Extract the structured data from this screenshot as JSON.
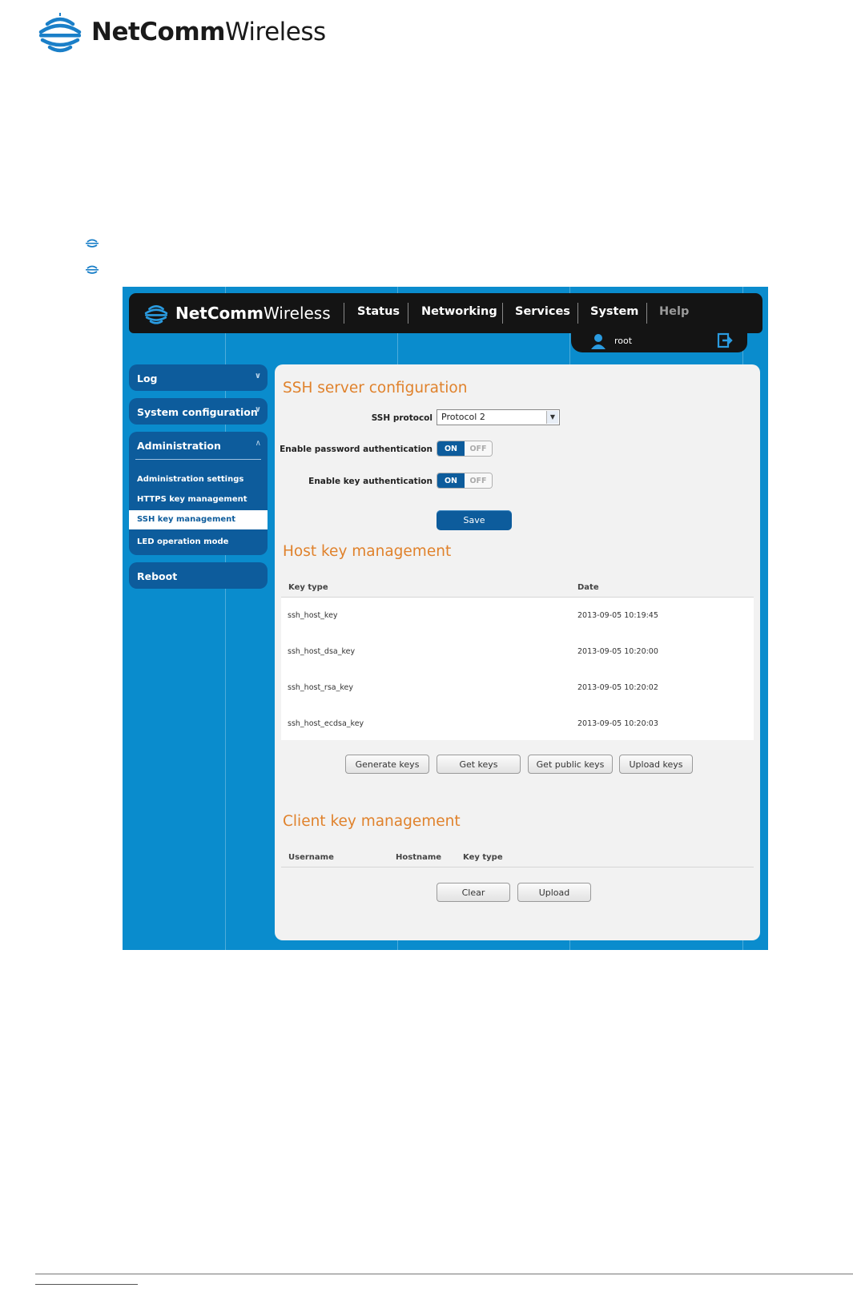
{
  "document": {
    "logo": {
      "brand_bold": "NetComm",
      "brand_light": "Wireless"
    }
  },
  "app": {
    "logo": {
      "brand_bold": "NetComm",
      "brand_light": "Wireless"
    },
    "nav": {
      "items": [
        {
          "label": "Status"
        },
        {
          "label": "Networking"
        },
        {
          "label": "Services"
        },
        {
          "label": "System"
        },
        {
          "label": "Help"
        }
      ],
      "user": "root"
    },
    "sidebar": {
      "log": "Log",
      "system_configuration": "System configuration",
      "administration": {
        "title": "Administration",
        "links": [
          {
            "label": "Administration settings"
          },
          {
            "label": "HTTPS key management"
          },
          {
            "label": "SSH key management"
          },
          {
            "label": "LED operation mode"
          }
        ]
      },
      "reboot": "Reboot"
    },
    "ssh_config": {
      "title": "SSH server configuration",
      "protocol_label": "SSH protocol",
      "protocol_value": "Protocol 2",
      "password_auth_label": "Enable password authentication",
      "key_auth_label": "Enable key authentication",
      "toggle_on": "ON",
      "toggle_off": "OFF",
      "save": "Save"
    },
    "host_keys": {
      "title": "Host key management",
      "columns": [
        "Key type",
        "Date"
      ],
      "rows": [
        {
          "key": "ssh_host_key",
          "date": "2013-09-05 10:19:45"
        },
        {
          "key": "ssh_host_dsa_key",
          "date": "2013-09-05 10:20:00"
        },
        {
          "key": "ssh_host_rsa_key",
          "date": "2013-09-05 10:20:02"
        },
        {
          "key": "ssh_host_ecdsa_key",
          "date": "2013-09-05 10:20:03"
        }
      ],
      "buttons": {
        "generate": "Generate keys",
        "get": "Get keys",
        "get_public": "Get public keys",
        "upload": "Upload keys"
      }
    },
    "client_keys": {
      "title": "Client key management",
      "columns": [
        "Username",
        "Hostname",
        "Key type"
      ],
      "buttons": {
        "clear": "Clear",
        "upload": "Upload"
      }
    }
  },
  "colors": {
    "accent_orange": "#e0822c",
    "nav_dark": "#141414",
    "frame_blue": "#0a8ccd",
    "sidebar_blue": "#0d5c9c"
  }
}
